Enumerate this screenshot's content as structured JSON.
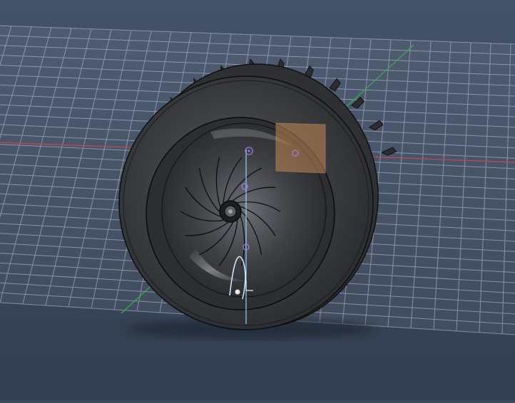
{
  "viewport": {
    "background_top": "#44526a",
    "background_bottom": "#333f50",
    "grid_color": "#b9c6d8",
    "axis_x_color": "#c8484c",
    "axis_y_color": "#36b04a",
    "axis_z_color": "#8fd3ff",
    "selection_color": "#c58a55",
    "model_body_color": "#3a3b3f",
    "gizmo_color": "#9b7fd6"
  },
  "scene": {
    "object": "turbo-compressor-wheel-with-housing",
    "blade_count": 14,
    "fin_count": 12
  }
}
